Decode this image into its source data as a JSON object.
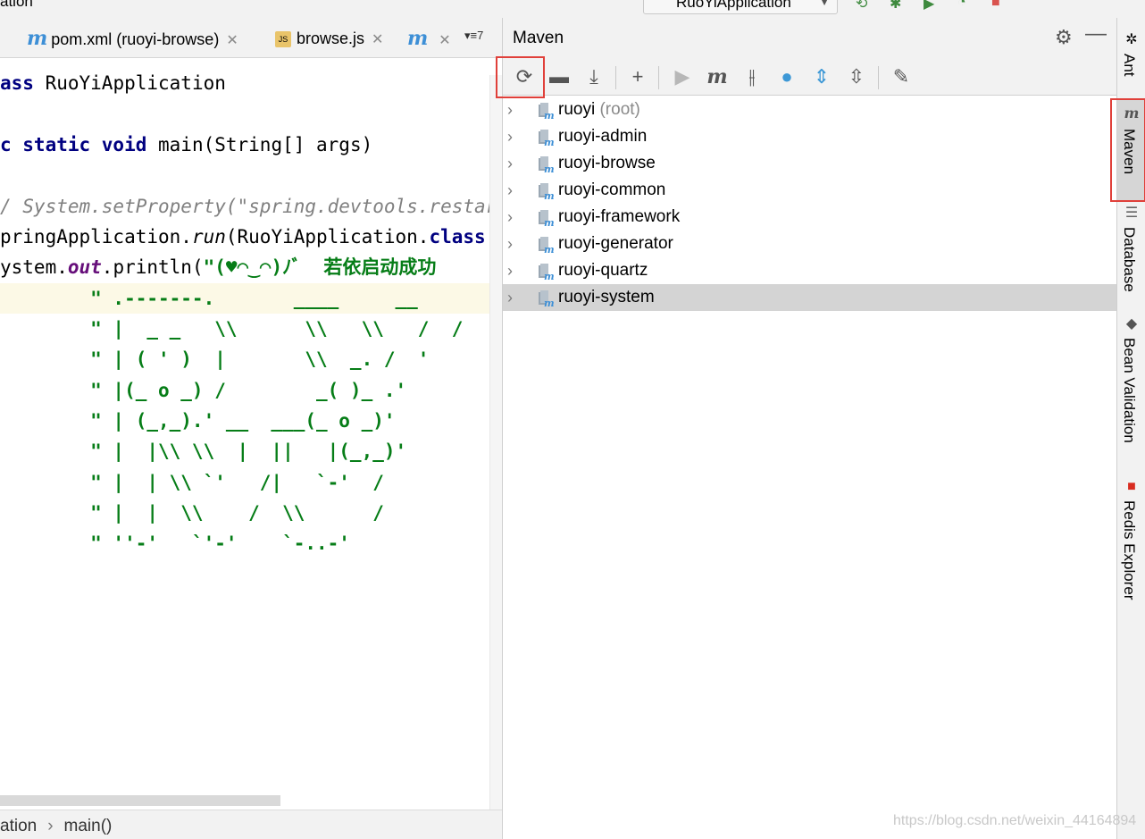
{
  "window": {
    "title_fragment": "ation",
    "run_config": "RuoYiApplication"
  },
  "editor": {
    "tabs": [
      {
        "label": "pom.xml (ruoyi-browse)",
        "icon": "maven-icon"
      },
      {
        "label": "browse.js",
        "icon": "js-file-icon"
      },
      {
        "label": "",
        "icon": "maven-icon"
      }
    ],
    "tab_overflow": "▾≡7",
    "code_lines": [
      "ass RuoYiApplication",
      "",
      "c static void main(String[] args)",
      "",
      "/ System.setProperty(\"spring.devtools.restar",
      "pringApplication.run(RuoYiApplication.class",
      "ystem.out.println(\"(♥◠‿◠)ﾉﾞ  若依启动成功",
      "        \" .-------.       ____     __",
      "        \" |  _ _   \\\\      \\\\   \\\\   /  /",
      "        \" | ( ' )  |       \\\\  _. /  '",
      "        \" |(_ o _) /        _( )_ .'",
      "        \" | (_,_).' __  ___(_ o _)'",
      "        \" |  |\\\\ \\\\  |  ||   |(_,_)'",
      "        \" |  | \\\\ `'   /|   `-'  /",
      "        \" |  |  \\\\    /  \\\\      /",
      "        \" ''-'   `'-'    `-..-'"
    ],
    "breadcrumb": {
      "class_fragment": "ation",
      "method": "main()"
    }
  },
  "maven": {
    "title": "Maven",
    "toolbar": [
      {
        "name": "reload-all-maven-projects-icon",
        "glyph": "⟳"
      },
      {
        "name": "generate-sources-icon",
        "glyph": "📂"
      },
      {
        "name": "download-sources-icon",
        "glyph": "⤓"
      },
      {
        "name": "add-maven-project-icon",
        "glyph": "+"
      },
      {
        "name": "run-maven-build-icon",
        "glyph": "▶"
      },
      {
        "name": "execute-maven-goal-icon",
        "glyph": "m"
      },
      {
        "name": "toggle-offline-mode-icon",
        "glyph": "⫲"
      },
      {
        "name": "skip-tests-icon",
        "glyph": "ϟ"
      },
      {
        "name": "show-dependencies-icon",
        "glyph": "⇕"
      },
      {
        "name": "collapse-all-icon",
        "glyph": "⇳"
      },
      {
        "name": "maven-settings-icon",
        "glyph": "🔧"
      }
    ],
    "projects": [
      {
        "name": "ruoyi",
        "suffix": "(root)"
      },
      {
        "name": "ruoyi-admin",
        "suffix": ""
      },
      {
        "name": "ruoyi-browse",
        "suffix": ""
      },
      {
        "name": "ruoyi-common",
        "suffix": ""
      },
      {
        "name": "ruoyi-framework",
        "suffix": ""
      },
      {
        "name": "ruoyi-generator",
        "suffix": ""
      },
      {
        "name": "ruoyi-quartz",
        "suffix": ""
      },
      {
        "name": "ruoyi-system",
        "suffix": ""
      }
    ],
    "selected_project": "ruoyi-system"
  },
  "tool_strip": [
    {
      "label": "Ant",
      "icon": "ant-icon"
    },
    {
      "label": "Maven",
      "icon": "maven-icon"
    },
    {
      "label": "Database",
      "icon": "database-icon"
    },
    {
      "label": "Bean Validation",
      "icon": "bean-validation-icon"
    },
    {
      "label": "Redis Explorer",
      "icon": "redis-icon"
    }
  ],
  "watermark": "https://blog.csdn.net/weixin_44164894",
  "colors": {
    "highlight_box": "#e0403a",
    "selection": "#d4d4d4",
    "maven_blue": "#3d8fd6"
  }
}
